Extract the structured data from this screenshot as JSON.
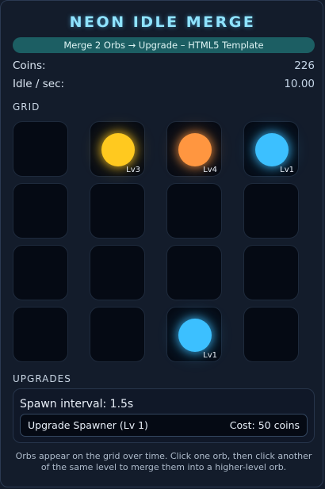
{
  "header": {
    "title": "NEON IDLE MERGE",
    "subtitle": "Merge 2 Orbs → Upgrade – HTML5 Template"
  },
  "stats": {
    "coins_label": "Coins:",
    "coins_value": "226",
    "idle_label": "Idle / sec:",
    "idle_value": "10.00"
  },
  "grid": {
    "label": "GRID",
    "columns": 4,
    "cells": [
      {
        "orb": null
      },
      {
        "orb": {
          "color": "#ffc91f",
          "level_label": "Lv3"
        }
      },
      {
        "orb": {
          "color": "#ff9640",
          "level_label": "Lv4"
        }
      },
      {
        "orb": {
          "color": "#3cc0ff",
          "level_label": "Lv1"
        }
      },
      {
        "orb": null
      },
      {
        "orb": null
      },
      {
        "orb": null
      },
      {
        "orb": null
      },
      {
        "orb": null
      },
      {
        "orb": null
      },
      {
        "orb": null
      },
      {
        "orb": null
      },
      {
        "orb": null
      },
      {
        "orb": null
      },
      {
        "orb": {
          "color": "#3cc0ff",
          "level_label": "Lv1"
        }
      },
      {
        "orb": null
      }
    ]
  },
  "upgrades": {
    "label": "UPGRADES",
    "spawn_interval": "Spawn interval: 1.5s",
    "button_label": "Upgrade Spawner (Lv 1)",
    "button_cost": "Cost: 50 coins"
  },
  "footer": {
    "instructions": "Orbs appear on the grid over time. Click one orb, then click another of the same level to merge them into a higher-level orb."
  }
}
